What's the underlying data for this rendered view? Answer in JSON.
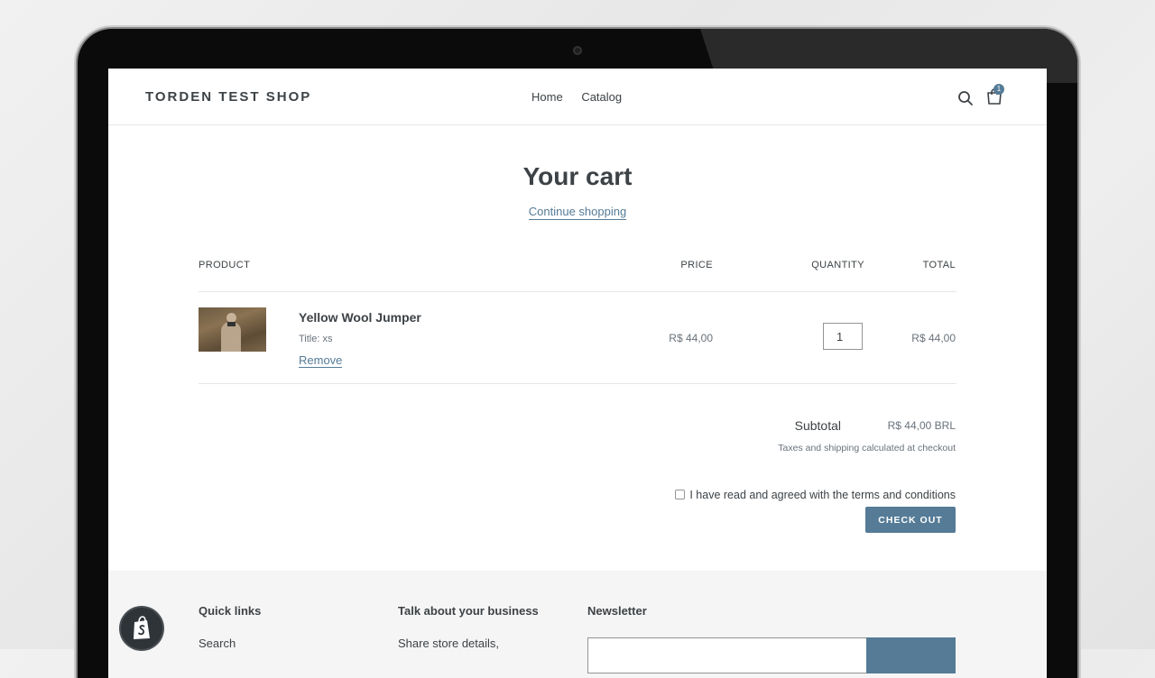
{
  "header": {
    "logo": "TORDEN TEST SHOP",
    "nav": [
      "Home",
      "Catalog"
    ],
    "cart_count": "1"
  },
  "cart": {
    "title": "Your cart",
    "continue_label": "Continue shopping",
    "columns": {
      "product": "PRODUCT",
      "price": "PRICE",
      "quantity": "QUANTITY",
      "total": "TOTAL"
    },
    "item": {
      "name": "Yellow Wool Jumper",
      "variant": "Title: xs",
      "remove_label": "Remove",
      "price": "R$ 44,00",
      "quantity": "1",
      "total": "R$ 44,00"
    },
    "subtotal_label": "Subtotal",
    "subtotal_value": "R$ 44,00 BRL",
    "taxes_note": "Taxes and shipping calculated at checkout",
    "terms_label": "I have read and agreed with the terms and conditions",
    "checkout_label": "CHECK OUT"
  },
  "footer": {
    "quick_links_heading": "Quick links",
    "quick_links": [
      "Search"
    ],
    "business_heading": "Talk about your business",
    "business_text": "Share store details,",
    "newsletter_heading": "Newsletter"
  },
  "colors": {
    "accent": "#557b97",
    "text": "#3d4246",
    "muted": "#69727b"
  },
  "icons": [
    "search-icon",
    "cart-icon",
    "shopify-logo-icon"
  ]
}
